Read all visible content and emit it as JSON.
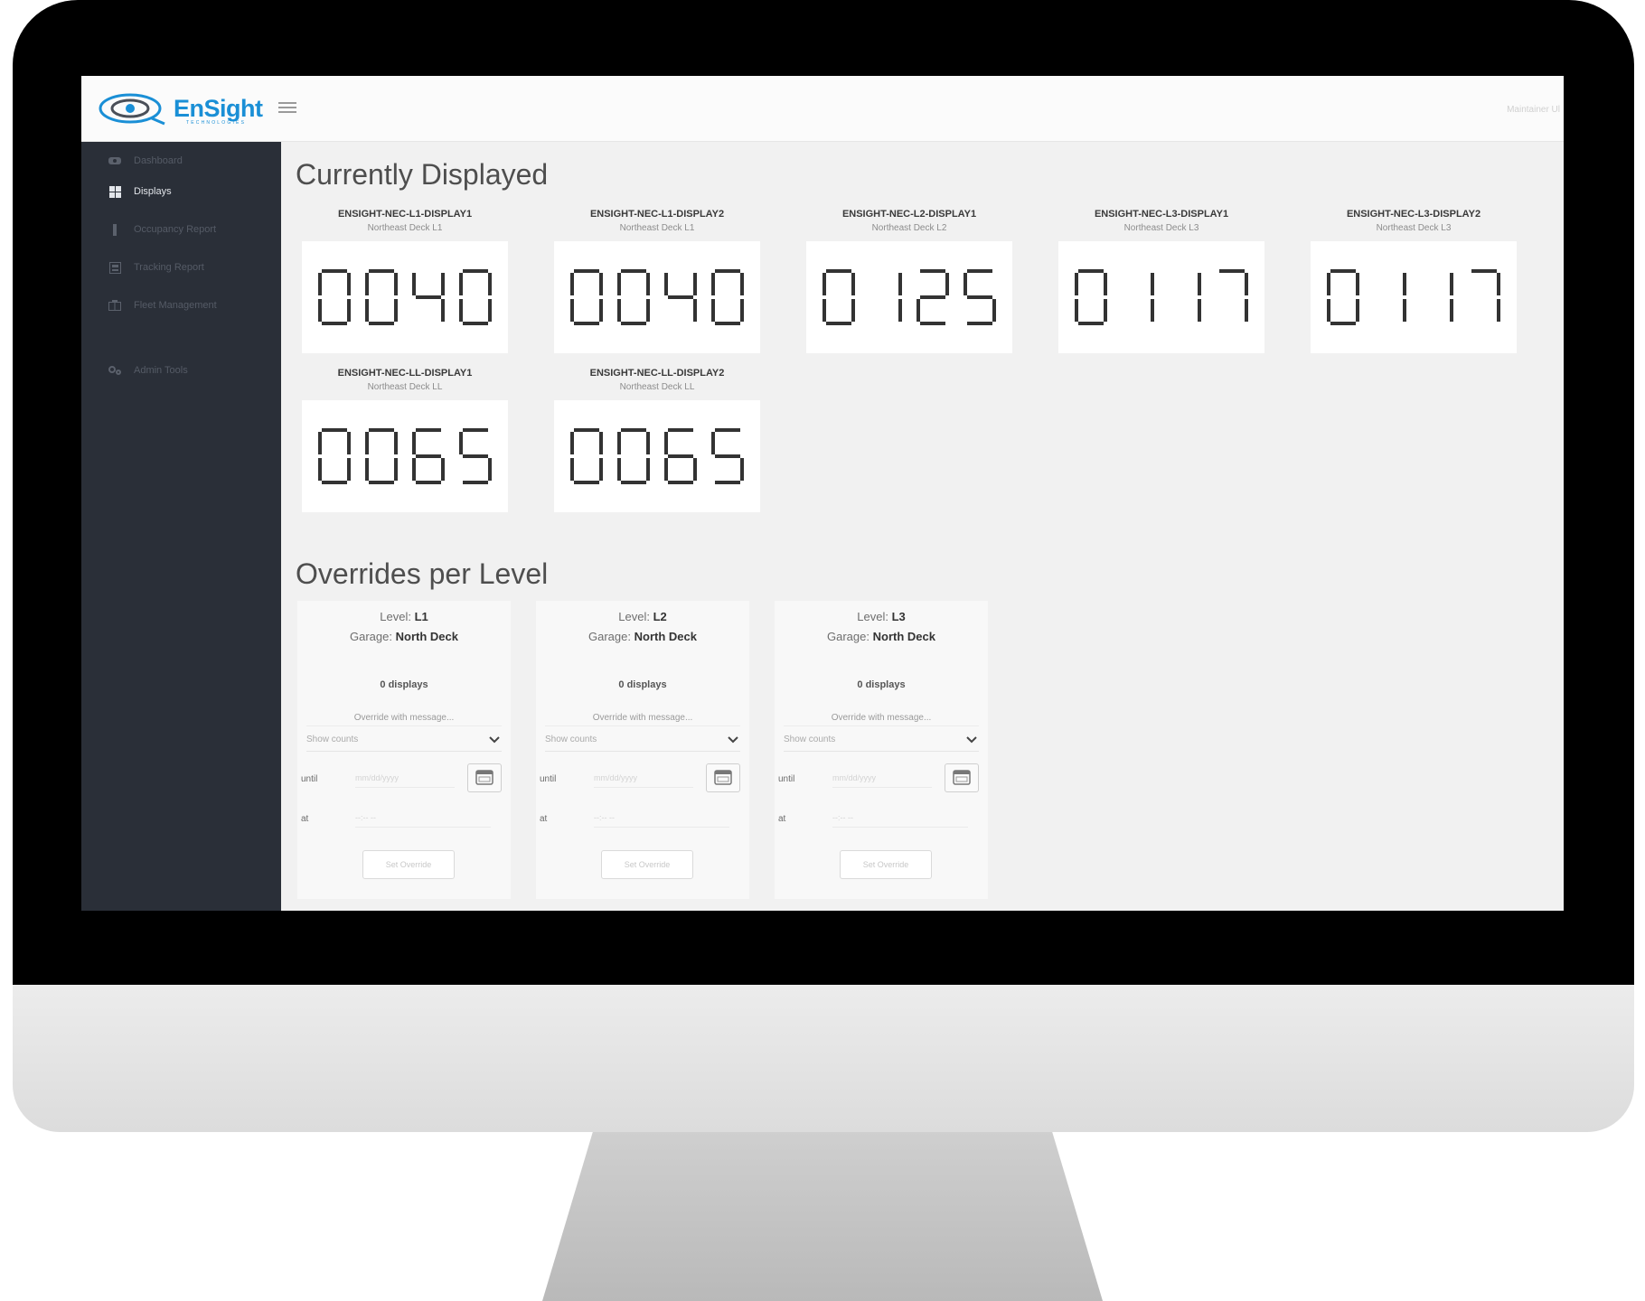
{
  "app": {
    "logo_text": "EnSight",
    "logo_subtitle": "TECHNOLOGIES",
    "user_label": "Maintainer Ul"
  },
  "sidebar": {
    "items": [
      {
        "label": "Dashboard",
        "icon": "dashboard-icon"
      },
      {
        "label": "Displays",
        "icon": "grid-icon",
        "active": true
      },
      {
        "label": "Occupancy Report",
        "icon": "occupancy-icon"
      },
      {
        "label": "Tracking Report",
        "icon": "report-icon"
      },
      {
        "label": "Fleet Management",
        "icon": "fleet-icon"
      },
      {
        "label": "Admin Tools",
        "icon": "tools-icon"
      }
    ]
  },
  "currently_displayed": {
    "title": "Currently Displayed",
    "displays": [
      {
        "name": "ENSIGHT-NEC-L1-DISPLAY1",
        "location": "Northeast Deck L1",
        "value": "0040"
      },
      {
        "name": "ENSIGHT-NEC-L1-DISPLAY2",
        "location": "Northeast Deck L1",
        "value": "0040"
      },
      {
        "name": "ENSIGHT-NEC-L2-DISPLAY1",
        "location": "Northeast Deck L2",
        "value": "0125"
      },
      {
        "name": "ENSIGHT-NEC-L3-DISPLAY1",
        "location": "Northeast Deck L3",
        "value": "0117"
      },
      {
        "name": "ENSIGHT-NEC-L3-DISPLAY2",
        "location": "Northeast Deck L3",
        "value": "0117"
      },
      {
        "name": "ENSIGHT-NEC-LL-DISPLAY1",
        "location": "Northeast Deck LL",
        "value": "0065"
      },
      {
        "name": "ENSIGHT-NEC-LL-DISPLAY2",
        "location": "Northeast Deck LL",
        "value": "0065"
      }
    ]
  },
  "overrides": {
    "title": "Overrides per Level",
    "levels": [
      {
        "level_label": "Level: ",
        "level": "L1",
        "garage_label": "Garage: ",
        "garage": "North Deck",
        "count": "0 displays",
        "message_placeholder": "Override with message...",
        "select_value": "Show counts",
        "until_label": "until",
        "until_placeholder": "mm/dd/yyyy",
        "at_label": "at",
        "at_placeholder": "--:-- --",
        "button_label": "Set Override"
      },
      {
        "level_label": "Level: ",
        "level": "L2",
        "garage_label": "Garage: ",
        "garage": "North Deck",
        "count": "0 displays",
        "message_placeholder": "Override with message...",
        "select_value": "Show counts",
        "until_label": "until",
        "until_placeholder": "mm/dd/yyyy",
        "at_label": "at",
        "at_placeholder": "--:-- --",
        "button_label": "Set Override"
      },
      {
        "level_label": "Level: ",
        "level": "L3",
        "garage_label": "Garage: ",
        "garage": "North Deck",
        "count": "0 displays",
        "message_placeholder": "Override with message...",
        "select_value": "Show counts",
        "until_label": "until",
        "until_placeholder": "mm/dd/yyyy",
        "at_label": "at",
        "at_placeholder": "--:-- --",
        "button_label": "Set Override"
      }
    ]
  },
  "colors": {
    "brand": "#1a8fd6",
    "sidebar_bg": "#2a2f38",
    "digit": "#333333"
  }
}
